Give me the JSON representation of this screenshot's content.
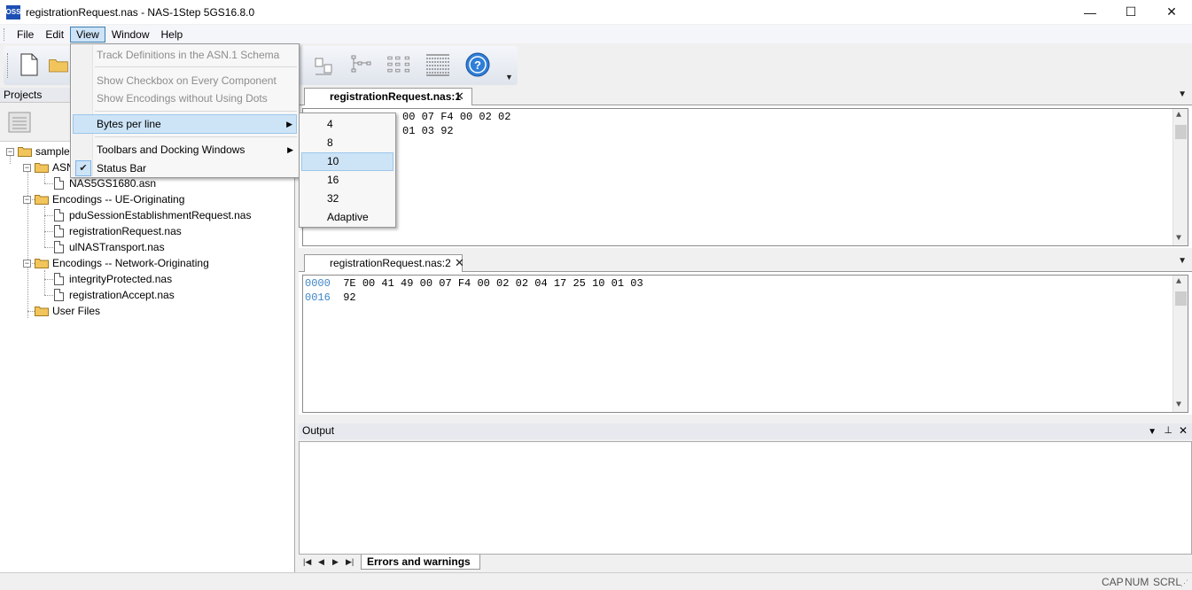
{
  "window": {
    "title": "registrationRequest.nas - NAS-1Step 5GS16.8.0",
    "app_icon_text": "OSS",
    "controls": {
      "minimize": "—",
      "maximize": "☐",
      "close": "✕"
    }
  },
  "menubar": {
    "items": [
      "File",
      "Edit",
      "View",
      "Window",
      "Help"
    ],
    "active": "View"
  },
  "view_menu": {
    "items": [
      {
        "label": "Track Definitions in the ASN.1 Schema",
        "disabled": true
      },
      {
        "label": "Show Checkbox on Every Component",
        "disabled": true
      },
      {
        "label": "Show Encodings without Using Dots",
        "disabled": true
      },
      {
        "label": "Bytes per line",
        "submenu": true,
        "highlighted": true
      },
      {
        "label": "Toolbars and Docking Windows",
        "submenu": true
      },
      {
        "label": "Status Bar",
        "checked": true
      }
    ]
  },
  "bytes_per_line_submenu": {
    "items": [
      "4",
      "8",
      "10",
      "16",
      "32",
      "Adaptive"
    ],
    "highlighted": "10"
  },
  "projects": {
    "header": "Projects",
    "tree": [
      {
        "label": "sample",
        "type": "folder"
      },
      {
        "label": "ASN",
        "type": "folder"
      },
      {
        "label": "NAS5GS1680.asn",
        "type": "file"
      },
      {
        "label": "Encodings -- UE-Originating",
        "type": "folder"
      },
      {
        "label": "pduSessionEstablishmentRequest.nas",
        "type": "file"
      },
      {
        "label": "registrationRequest.nas",
        "type": "file"
      },
      {
        "label": "ulNASTransport.nas",
        "type": "file"
      },
      {
        "label": "Encodings -- Network-Originating",
        "type": "folder"
      },
      {
        "label": "integrityProtected.nas",
        "type": "file"
      },
      {
        "label": "registrationAccept.nas",
        "type": "file"
      },
      {
        "label": "User Files",
        "type": "folder"
      }
    ]
  },
  "editor1": {
    "tab": "registrationRequest.nas:1",
    "lines": [
      {
        "offset": "",
        "hex": "1 49 00 07 F4 00 02 02"
      },
      {
        "offset": "",
        "hex": "5 10 01 03 92"
      }
    ]
  },
  "editor2": {
    "tab": "registrationRequest.nas:2",
    "lines": [
      {
        "offset": "0000",
        "hex": "7E 00 41 49 00 07 F4 00 02 02 04 17 25 10 01 03"
      },
      {
        "offset": "0016",
        "hex": "92"
      }
    ]
  },
  "output": {
    "header": "Output",
    "tab": "Errors and warnings"
  },
  "statusbar": {
    "cap": "CAP",
    "num": "NUM",
    "scrl": "SCRL"
  },
  "colors": {
    "offset": "#3e86c6",
    "menu_highlight": "#cde4f7",
    "folder": "#f2c55c"
  }
}
